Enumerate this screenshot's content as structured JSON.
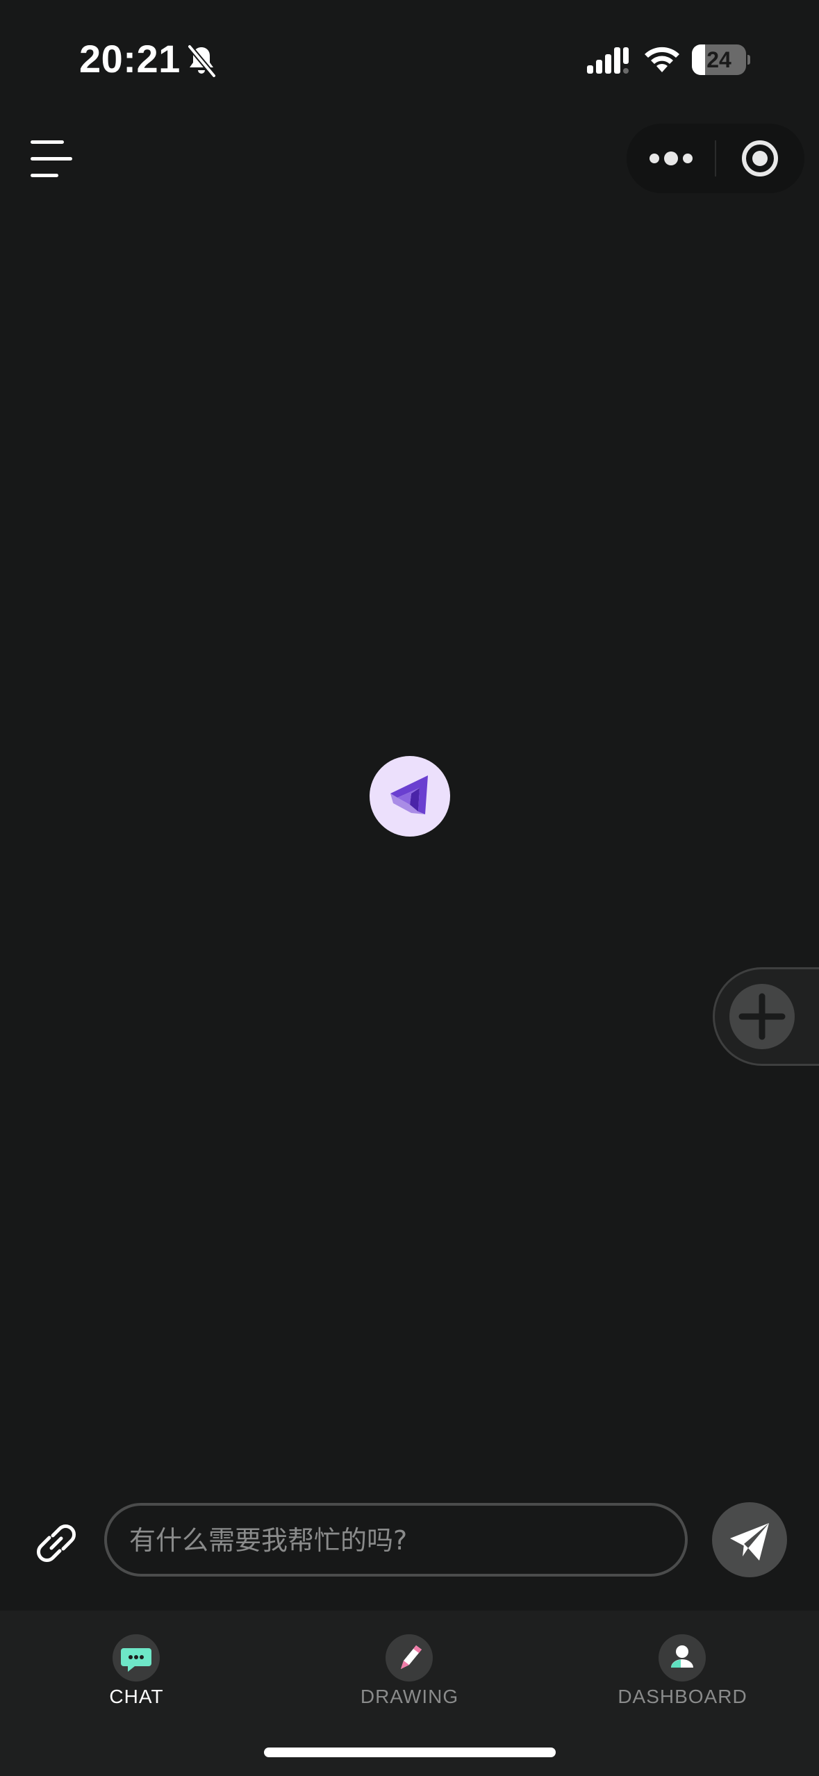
{
  "status_bar": {
    "time": "20:21",
    "battery_level": "24",
    "battery_fraction": 0.24,
    "icons": [
      "bell-off-icon",
      "signal-icon",
      "wifi-icon",
      "battery-icon"
    ]
  },
  "top_bar": {
    "menu_icon": "hamburger-menu-icon",
    "capsule": {
      "more_icon": "more-dots-icon",
      "close_icon": "target-circle-icon"
    }
  },
  "center": {
    "logo_icon": "app-logo-icon"
  },
  "floating_action": {
    "icon": "plus-icon"
  },
  "composer": {
    "attach_icon": "paperclip-icon",
    "input_placeholder": "有什么需要我帮忙的吗?",
    "input_value": "",
    "send_icon": "paper-plane-icon"
  },
  "tabs": [
    {
      "label": "CHAT",
      "icon": "chat-bubble-icon",
      "active": true
    },
    {
      "label": "DRAWING",
      "icon": "pencil-icon",
      "active": false
    },
    {
      "label": "DASHBOARD",
      "icon": "user-icon",
      "active": false
    }
  ],
  "colors": {
    "background": "#171818",
    "tab_bar": "#1e1f1f",
    "active_tab_text": "#ffffff",
    "inactive_tab_text": "#8a8b8b",
    "logo_bg": "#ece0fc",
    "logo_purple": "#6a3fd0",
    "chat_icon_green": "#6ee7c8",
    "drawing_icon_pink": "#f07ca8",
    "dashboard_icon_teal": "#5fe0c0"
  }
}
